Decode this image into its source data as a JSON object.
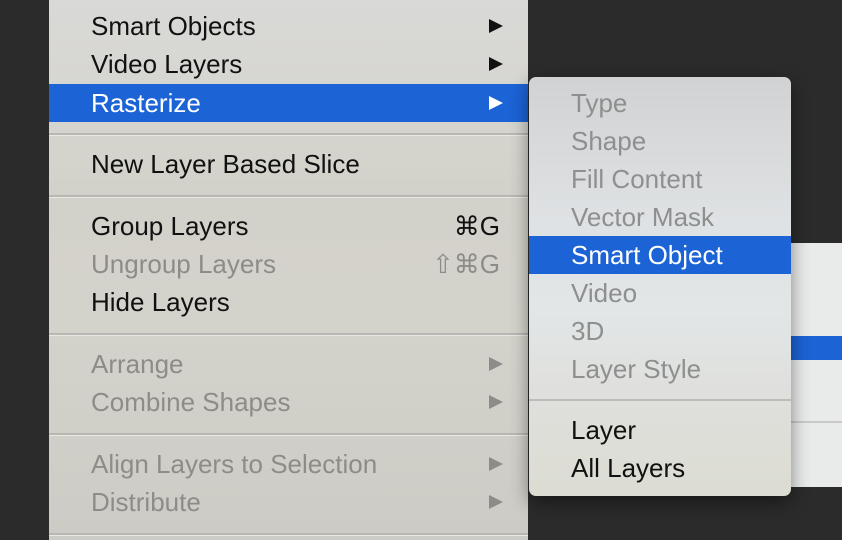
{
  "layer_menu": {
    "items": [
      {
        "label": "Smart Objects",
        "submenu": true
      },
      {
        "label": "Video Layers",
        "submenu": true
      },
      {
        "label": "Rasterize",
        "submenu": true,
        "selected": true
      },
      {
        "label": "New Layer Based Slice"
      },
      {
        "label": "Group Layers",
        "shortcut": "⌘G"
      },
      {
        "label": "Ungroup Layers",
        "shortcut": "⇧⌘G",
        "disabled": true
      },
      {
        "label": "Hide Layers"
      },
      {
        "label": "Arrange",
        "submenu": true,
        "disabled": true
      },
      {
        "label": "Combine Shapes",
        "submenu": true,
        "disabled": true
      },
      {
        "label": "Align Layers to Selection",
        "submenu": true,
        "disabled": true
      },
      {
        "label": "Distribute",
        "submenu": true,
        "disabled": true
      }
    ]
  },
  "rasterize_submenu": {
    "items": [
      {
        "label": "Type",
        "disabled": true
      },
      {
        "label": "Shape",
        "disabled": true
      },
      {
        "label": "Fill Content",
        "disabled": true
      },
      {
        "label": "Vector Mask",
        "disabled": true
      },
      {
        "label": "Smart Object",
        "selected": true
      },
      {
        "label": "Video",
        "disabled": true
      },
      {
        "label": "3D",
        "disabled": true
      },
      {
        "label": "Layer Style",
        "disabled": true
      },
      {
        "label": "Layer"
      },
      {
        "label": "All Layers"
      }
    ]
  },
  "colors": {
    "selection": "#1c63d5",
    "disabled_text": "#8d8c89",
    "app_background": "#2b2b2b"
  }
}
